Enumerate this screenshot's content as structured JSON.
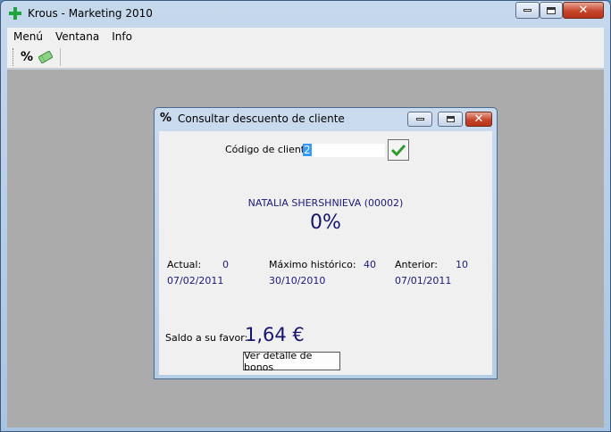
{
  "app": {
    "title": "Krous - Marketing 2010"
  },
  "menubar": {
    "items": [
      "Menú",
      "Ventana",
      "Info"
    ]
  },
  "toolbar": {
    "icons": [
      "percent-icon",
      "ticket-icon"
    ]
  },
  "dialog": {
    "title": "Consultar descuento de cliente",
    "code_label": "Código de cliente",
    "code_value": "2",
    "client_name": "NATALIA SHERSHNIEVA (00002)",
    "discount": "0%",
    "actual": {
      "label": "Actual:",
      "value": "0",
      "date": "07/02/2011"
    },
    "maximo": {
      "label": "Máximo histórico:",
      "value": "40",
      "date": "30/10/2010"
    },
    "anterior": {
      "label": "Anterior:",
      "value": "10",
      "date": "07/01/2011"
    },
    "saldo_label": "Saldo a su favor:",
    "saldo_value": "1,64 €",
    "detail_button": "Ver detalle de bonos"
  },
  "colors": {
    "accent_text": "#1a1a7a",
    "title_gradient": "#c6d8ec",
    "mdi_background": "#ababab"
  }
}
